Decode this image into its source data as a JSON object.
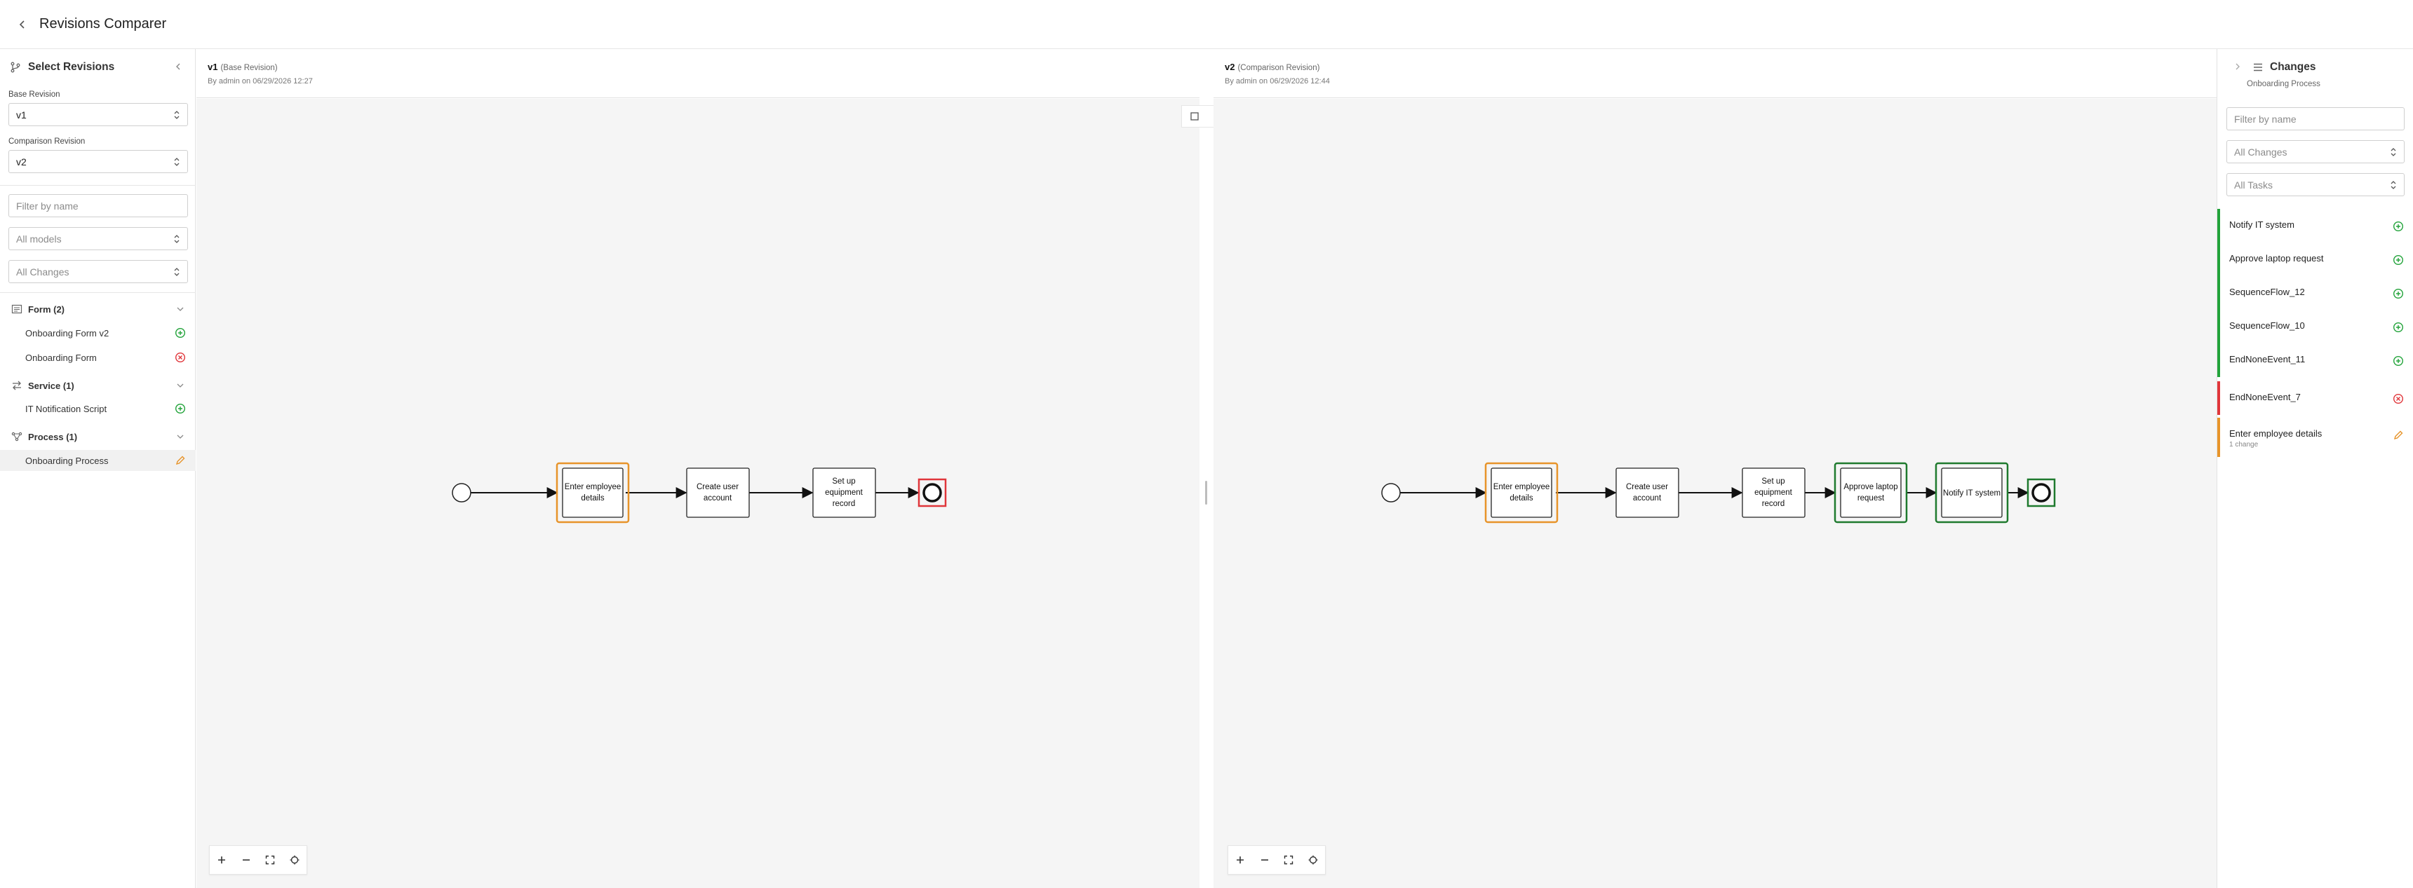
{
  "app": {
    "title": "Revisions Comparer"
  },
  "left": {
    "title": "Select Revisions",
    "base_label": "Base Revision",
    "base_value": "v1",
    "comparison_label": "Comparison Revision",
    "comparison_value": "v2",
    "filter_placeholder": "Filter by name",
    "models_value": "All models",
    "changes_value": "All Changes",
    "groups": [
      {
        "title": "Form (2)",
        "icon": "form-icon",
        "items": [
          {
            "label": "Onboarding Form v2",
            "status": "added"
          },
          {
            "label": "Onboarding Form",
            "status": "removed"
          }
        ]
      },
      {
        "title": "Service (1)",
        "icon": "service-icon",
        "items": [
          {
            "label": "IT Notification Script",
            "status": "added"
          }
        ]
      },
      {
        "title": "Process (1)",
        "icon": "process-icon",
        "items": [
          {
            "label": "Onboarding Process",
            "status": "modified"
          }
        ]
      }
    ]
  },
  "base": {
    "version": "v1",
    "role": "(Base Revision)",
    "by": "By admin on 06/29/2026 12:27",
    "tasks": [
      "Enter employee details",
      "Create user account",
      "Set up equipment record"
    ]
  },
  "comparison": {
    "version": "v2",
    "role": "(Comparison Revision)",
    "by": "By admin on 06/29/2026 12:44",
    "tasks": [
      "Enter employee details",
      "Create user account",
      "Set up equipment record",
      "Approve laptop request",
      "Notify IT system"
    ]
  },
  "right": {
    "title": "Changes",
    "subtitle": "Onboarding Process",
    "filter_placeholder": "Filter by name",
    "changes_value": "All Changes",
    "tasks_value": "All Tasks",
    "changes": [
      {
        "label": "Notify IT system",
        "status": "added"
      },
      {
        "label": "Approve laptop request",
        "status": "added"
      },
      {
        "label": "SequenceFlow_12",
        "status": "added"
      },
      {
        "label": "SequenceFlow_10",
        "status": "added"
      },
      {
        "label": "EndNoneEvent_11",
        "status": "added"
      },
      {
        "label": "EndNoneEvent_7",
        "status": "removed"
      },
      {
        "label": "Enter employee details",
        "status": "modified",
        "detail": "1 change"
      }
    ]
  },
  "colors": {
    "added": "#22a33a",
    "removed": "#e0363b",
    "modified": "#e7942a",
    "added_border": "#1f7a2e",
    "accent": "#2b6cb0"
  }
}
